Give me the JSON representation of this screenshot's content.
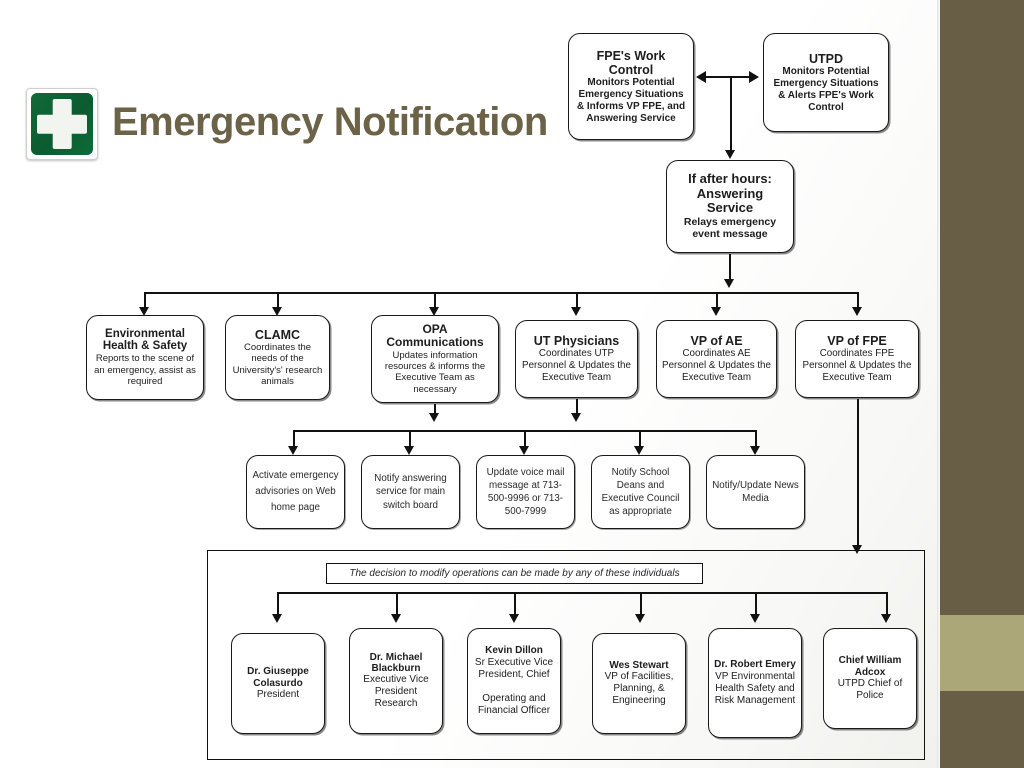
{
  "slide": {
    "title": "Emergency Notification",
    "logo_icon": "first-aid-cross-icon",
    "accent_dark": "#685e46",
    "accent_light": "#aca778",
    "title_color": "#6c6247",
    "logo_green": "#0d6436"
  },
  "tier1": [
    {
      "id": "fpe-work-control",
      "head": "FPE's Work Control",
      "body": "Monitors Potential Emergency Situations & Informs VP FPE, and Answering Service"
    },
    {
      "id": "utpd",
      "head": "UTPD",
      "body": "Monitors Potential Emergency Situations & Alerts FPE's Work Control"
    }
  ],
  "tier2": {
    "id": "answering-service",
    "head": "If after hours: Answering Service",
    "body": "Relays emergency event message"
  },
  "tier3": [
    {
      "id": "ehs",
      "head": "Environmental Health & Safety",
      "body": "Reports to the scene of an emergency, assist as required"
    },
    {
      "id": "clamc",
      "head": "CLAMC",
      "body": "Coordinates the needs of the University's' research animals"
    },
    {
      "id": "opa-communications",
      "head": "OPA Communications",
      "body": "Updates information resources & informs the Executive Team as necessary"
    },
    {
      "id": "ut-physicians",
      "head": "UT Physicians",
      "body": "Coordinates UTP Personnel & Updates the Executive Team"
    },
    {
      "id": "vp-of-ae",
      "head": "VP of AE",
      "body": "Coordinates AE Personnel & Updates the Executive Team"
    },
    {
      "id": "vp-of-fpe",
      "head": "VP of FPE",
      "body": "Coordinates FPE Personnel & Updates the Executive Team"
    }
  ],
  "tier4": [
    {
      "id": "activate-advisories",
      "body": "Activate emergency advisories on Web home page"
    },
    {
      "id": "notify-answering-service",
      "body": "Notify answering service for main switch board"
    },
    {
      "id": "update-voice-mail",
      "body": "Update voice mail message at 713-500-9996 or 713-500-7999"
    },
    {
      "id": "notify-school-deans",
      "body": "Notify School Deans and Executive Council as appropriate"
    },
    {
      "id": "notify-news-media",
      "body": "Notify/Update News Media"
    }
  ],
  "panel": {
    "caption": "The decision to modify operations can be made by any of these individuals",
    "people": [
      {
        "id": "giuseppe-colasurdo",
        "name": "Dr. Giuseppe Colasurdo",
        "role": "President"
      },
      {
        "id": "michael-blackburn",
        "name": "Dr. Michael Blackburn",
        "role": "Executive Vice President Research"
      },
      {
        "id": "kevin-dillon",
        "name": "Kevin Dillon",
        "role": "Sr Executive Vice President, Chief\n\nOperating and Financial Officer"
      },
      {
        "id": "wes-stewart",
        "name": "Wes Stewart",
        "role": "VP of Facilities, Planning, & Engineering"
      },
      {
        "id": "robert-emery",
        "name": "Dr. Robert Emery",
        "role": "VP Environmental Health Safety and Risk Management"
      },
      {
        "id": "william-adcox",
        "name": "Chief William Adcox",
        "role": "UTPD Chief of Police"
      }
    ]
  }
}
